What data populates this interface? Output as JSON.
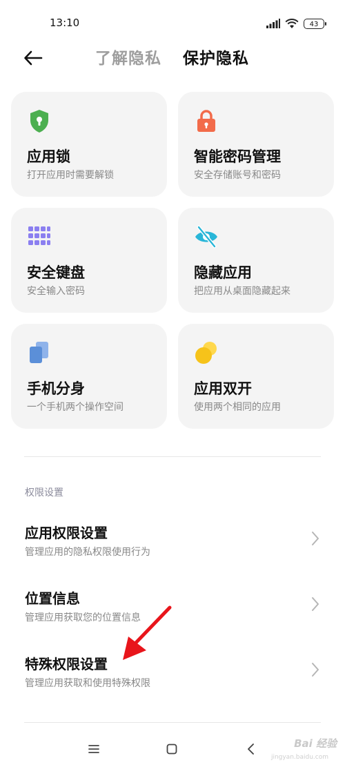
{
  "status_bar": {
    "time": "13:10",
    "battery": "43"
  },
  "header": {
    "tab_inactive": "了解隐私",
    "tab_active": "保护隐私"
  },
  "cards": [
    {
      "title": "应用锁",
      "subtitle": "打开应用时需要解锁",
      "icon": "shield-lock-icon",
      "color": "#4caf50"
    },
    {
      "title": "智能密码管理",
      "subtitle": "安全存储账号和密码",
      "icon": "padlock-icon",
      "color": "#f26b4a"
    },
    {
      "title": "安全键盘",
      "subtitle": "安全输入密码",
      "icon": "keyboard-grid-icon",
      "color": "#8b7ff0"
    },
    {
      "title": "隐藏应用",
      "subtitle": "把应用从桌面隐藏起来",
      "icon": "eye-off-icon",
      "color": "#29b6d8"
    },
    {
      "title": "手机分身",
      "subtitle": "一个手机两个操作空间",
      "icon": "dual-phone-icon",
      "color": "#5b8fd8"
    },
    {
      "title": "应用双开",
      "subtitle": "使用两个相同的应用",
      "icon": "dual-circle-icon",
      "color": "#f6c31a"
    }
  ],
  "permissions": {
    "section_label": "权限设置",
    "items": [
      {
        "title": "应用权限设置",
        "subtitle": "管理应用的隐私权限使用行为"
      },
      {
        "title": "位置信息",
        "subtitle": "管理应用获取您的位置信息"
      },
      {
        "title": "特殊权限设置",
        "subtitle": "管理应用获取和使用特殊权限"
      }
    ]
  },
  "annotation": {
    "arrow_color": "#e8151b"
  },
  "watermark": {
    "brand": "Bai 经验",
    "url": "jingyan.baidu.com"
  }
}
